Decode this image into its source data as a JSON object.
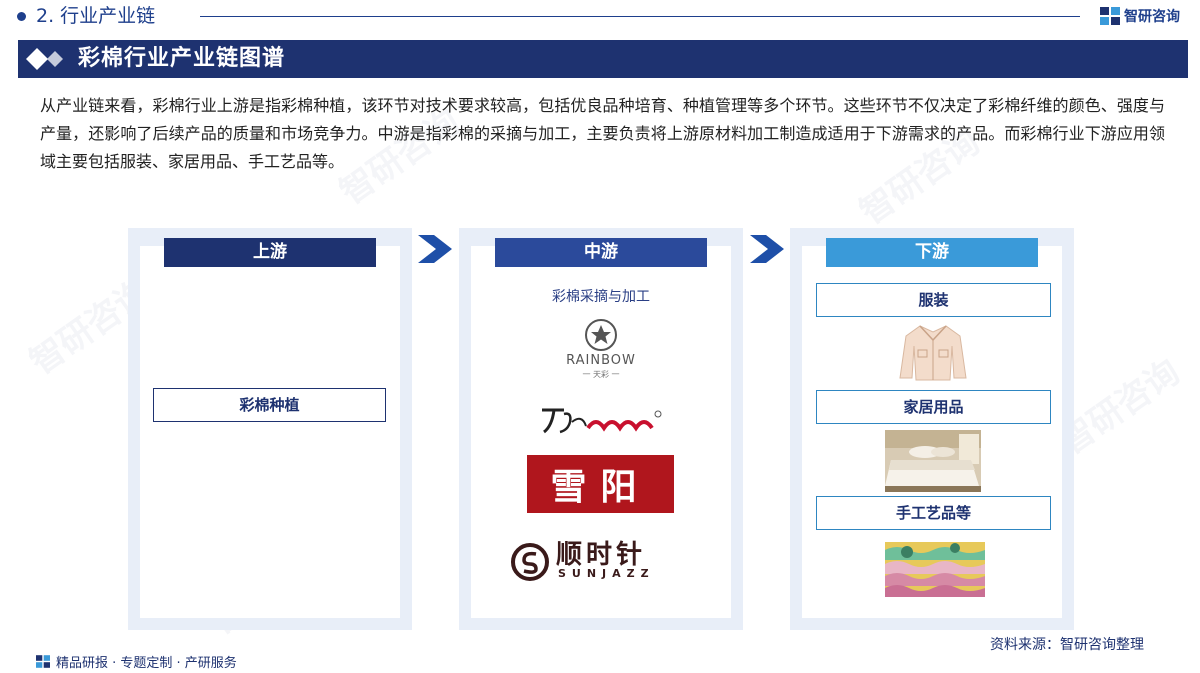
{
  "header": {
    "section_title": "2. 行业产业链",
    "brand_name": "智研咨询"
  },
  "banner": {
    "title": "彩棉行业产业链图谱"
  },
  "description": "从产业链来看，彩棉行业上游是指彩棉种植，该环节对技术要求较高，包括优良品种培育、种植管理等多个环节。这些环节不仅决定了彩棉纤维的颜色、强度与产量，还影响了后续产品的质量和市场竞争力。中游是指彩棉的采摘与加工，主要负责将上游原材料加工制造成适用于下游需求的产品。而彩棉行业下游应用领域主要包括服装、家居用品、手工艺品等。",
  "upstream": {
    "header": "上游",
    "item": "彩棉种植"
  },
  "midstream": {
    "header": "中游",
    "subtitle": "彩棉采摘与加工",
    "logos": {
      "rainbow": {
        "name": "RAINBOW",
        "sub": "一 天彩 一"
      },
      "xueyang": {
        "name": "雪阳"
      },
      "sunjazz": {
        "name": "顺时针",
        "sub": "SUNJAZZ"
      }
    }
  },
  "downstream": {
    "header": "下游",
    "items": [
      "服装",
      "家居用品",
      "手工艺品等"
    ]
  },
  "source": "资料来源：智研咨询整理",
  "footer": "精品研报 · 专题定制 · 产研服务",
  "watermark": "智研咨询",
  "colors": {
    "navy": "#1e3270",
    "mid_blue": "#2b4a9b",
    "light_blue": "#3a9ad9",
    "logo_red": "#b0161d"
  }
}
